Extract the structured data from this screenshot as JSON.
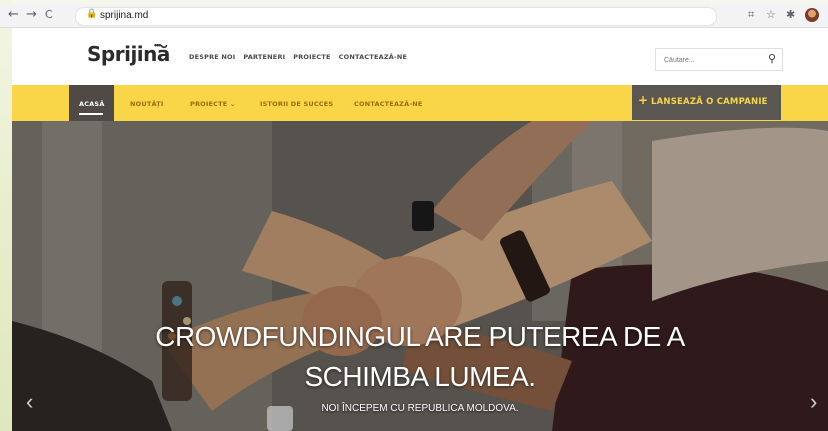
{
  "browser": {
    "url": "sprijina.md",
    "back": "←",
    "forward": "→",
    "reload": "C",
    "lock": "🔒",
    "icons": [
      "translate-icon",
      "star-icon",
      "extensions-icon"
    ]
  },
  "site": {
    "logo": "Sprijină",
    "logo_dots": "•••",
    "top_links": [
      "DESPRE NOI",
      "PARTENERI",
      "PROIECTE",
      "CONTACTEAZĂ-NE"
    ],
    "search_placeholder": "Căutare...",
    "search_icon": "⚲",
    "nav": {
      "items": [
        "ACASĂ",
        "NOUTĂȚI",
        "PROIECTE ⌄",
        "ISTORII DE SUCCES",
        "CONTACTEAZĂ-NE"
      ],
      "active": "ACASĂ"
    },
    "campaign": {
      "plus": "+",
      "label": "LANSEAZĂ O CAMPANIE"
    },
    "hero": {
      "title_line1": "CROWDFUNDINGUL ARE PUTEREA DE A",
      "title_line2": "SCHIMBA LUMEA.",
      "subtitle": "NOI ÎNCEPEM CU REPUBLICA MOLDOVA.",
      "prev": "‹",
      "next": "›"
    }
  },
  "colors": {
    "accent": "#f9d648",
    "dark": "#5a5651",
    "nav_text": "#9a6a08"
  }
}
